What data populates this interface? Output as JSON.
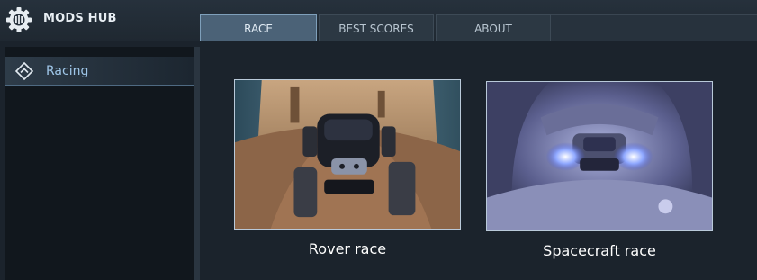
{
  "app": {
    "title": "MODS HUB",
    "logo_icon": "gear-logo-icon"
  },
  "tabs": [
    {
      "label": "RACE",
      "active": true
    },
    {
      "label": "BEST SCORES",
      "active": false
    },
    {
      "label": "ABOUT",
      "active": false
    }
  ],
  "sidebar": {
    "items": [
      {
        "label": "Racing",
        "icon": "diamond-chevron-icon",
        "selected": true
      }
    ]
  },
  "cards": [
    {
      "caption": "Rover race",
      "thumbnail": "rover-race-image"
    },
    {
      "caption": "Spacecraft race",
      "thumbnail": "spacecraft-race-image"
    }
  ],
  "colors": {
    "background": "#1b232c",
    "sidebar": "#11171d",
    "tab_active": "#4b6277",
    "accent_text": "#9fc6e8"
  }
}
